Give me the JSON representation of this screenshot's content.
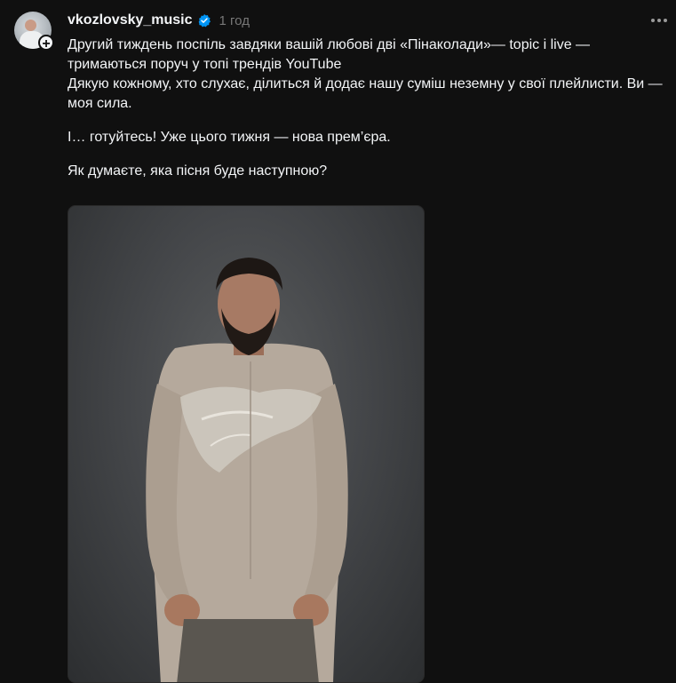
{
  "post": {
    "username": "vkozlovsky_music",
    "time": "1 год",
    "paragraphs": [
      "Другий тиждень поспіль завдяки вашій любові дві «Пінаколади»— topic і live — тримаються поруч у топі трендів YouTube",
      "Дякую кожному, хто слухає, ділиться й додає нашу суміш неземну у свої плейлисти. Ви — моя сила.",
      "І… готуйтесь! Уже цього тижня — нова прем’єра.",
      "Як думаєте, яка пісня буде наступною?"
    ]
  },
  "icons": {
    "verified": "verified-badge-icon",
    "follow": "plus-icon",
    "more": "more-horizontal-icon"
  },
  "colors": {
    "background": "#101010",
    "text": "#f3f5f7",
    "secondary": "#777777",
    "verified": "#0095f6"
  }
}
